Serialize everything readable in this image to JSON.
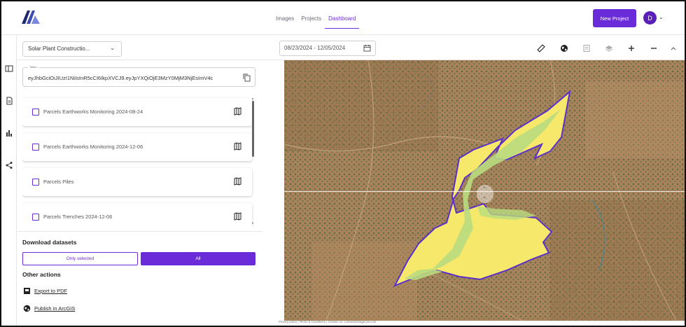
{
  "nav": {
    "items": [
      {
        "label": "Images",
        "active": false
      },
      {
        "label": "Projects",
        "active": false
      },
      {
        "label": "Dashboard",
        "active": true
      }
    ]
  },
  "header": {
    "new_project_label": "New Project",
    "avatar_initial": "D"
  },
  "toolbar": {
    "project_select_value": "Solar Plant Constructio...",
    "date_range": "08/23/2024 - 12/05/2024",
    "tools": [
      "ruler-icon",
      "globe-icon",
      "legend-icon",
      "layers-icon",
      "zoom-in-icon",
      "zoom-out-icon",
      "collapse-icon"
    ]
  },
  "panel": {
    "token_label": "Token",
    "token_value": "eyJhbGciOiJIUzI1NiIsInR5cCI6IkpXVCJ9.eyJpYXQiOjE3MzY0MjM3NjEsImV4c",
    "datasets": [
      {
        "label": "Parcels Earthworks Monitoring 2024-08-24",
        "checked": false
      },
      {
        "label": "Parcels Earthworks Monitoring 2024-12-06",
        "checked": false
      },
      {
        "label": "Parcels Piles",
        "checked": false
      },
      {
        "label": "Parcels Trenches 2024-12-06",
        "checked": false
      }
    ],
    "download_heading": "Download datasets",
    "only_selected_label": "Only selected",
    "all_label": "All",
    "other_actions_heading": "Other actions",
    "export_pdf_label": "Export to PDF",
    "publish_arcgis_label": "Publish in ArcGIS"
  },
  "map": {
    "polygon_fill": "#f6e86a",
    "polygon_inner_fill": "#b9dc7f",
    "polygon_stroke": "#5b2fc9"
  },
  "footer": {
    "text": "Privacy policy | Terms & Conditions | Contact us: contact@imagerysl.com"
  },
  "colors": {
    "accent": "#6a2bd9"
  }
}
